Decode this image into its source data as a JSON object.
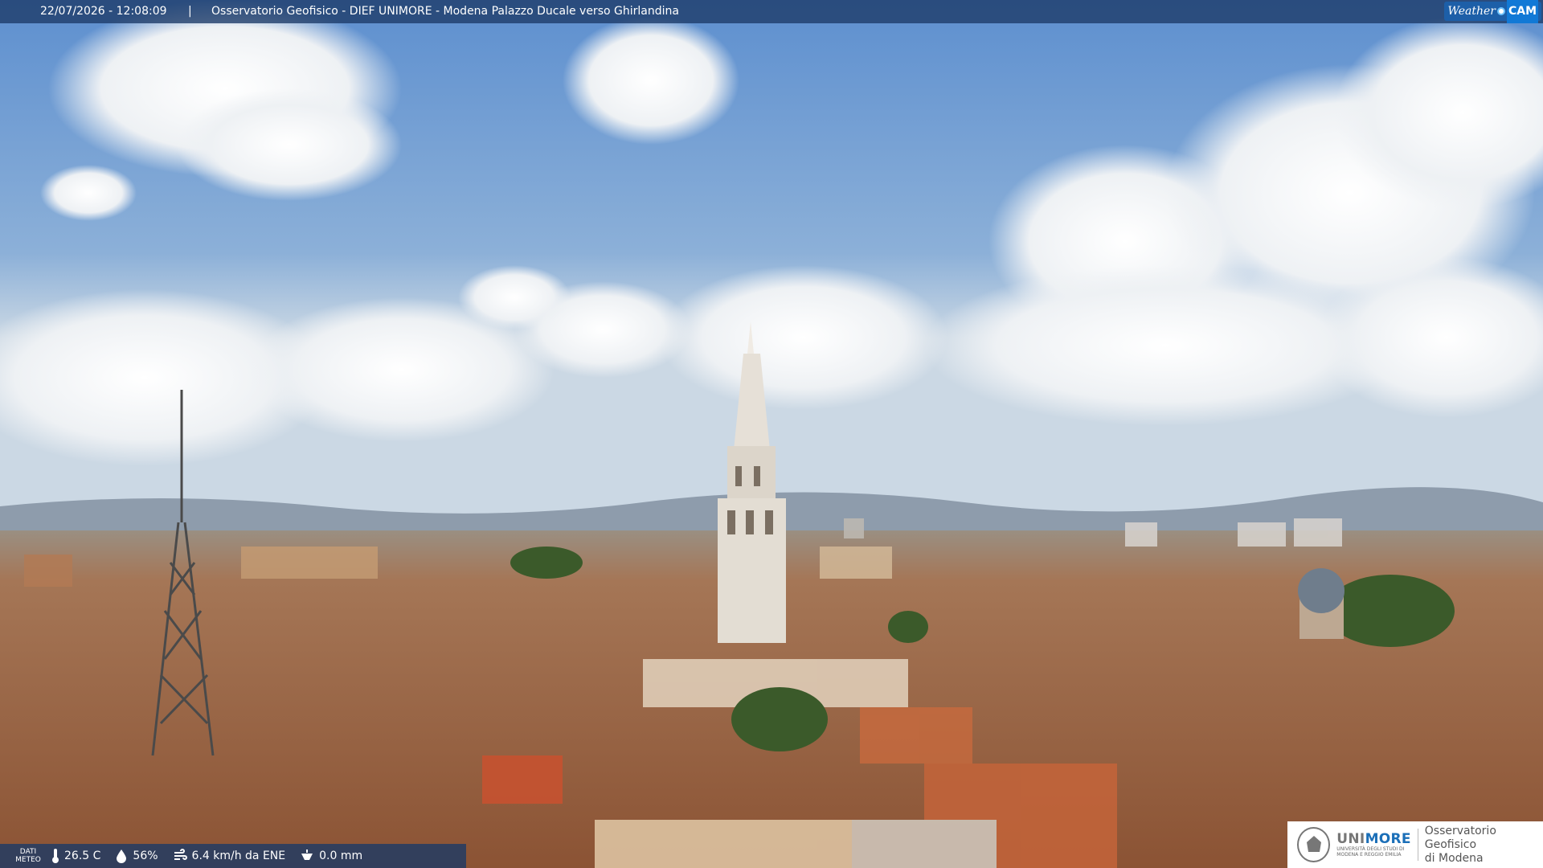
{
  "header": {
    "datetime": "22/07/2026 - 12:08:09",
    "separator": "|",
    "title": "Osservatorio Geofisico - DIEF UNIMORE - Modena Palazzo Ducale verso Ghirlandina",
    "logo_left": "Weather",
    "logo_right": "CAM"
  },
  "footer": {
    "dati_line1": "DATI",
    "dati_line2": "METEO",
    "temperature": "26.5 C",
    "humidity": "56%",
    "wind": "6.4 km/h da ENE",
    "rain": "0.0 mm"
  },
  "sponsor": {
    "brand_prefix": "UNI",
    "brand_suffix": "MORE",
    "sub_line1": "UNIVERSITÀ DEGLI STUDI DI",
    "sub_line2": "MODENA E REGGIO EMILIA",
    "obs_line1": "Osservatorio Geofisico",
    "obs_line2": "di Modena"
  },
  "colors": {
    "sky_top": "#5d8fcf",
    "sky_bottom": "#cbd8e4",
    "roof": "#b0714a",
    "bar": "#1c3a66"
  },
  "icons": {
    "temperature": "thermometer-icon",
    "humidity": "droplet-icon",
    "wind": "wind-icon",
    "rain": "rain-gauge-icon"
  }
}
